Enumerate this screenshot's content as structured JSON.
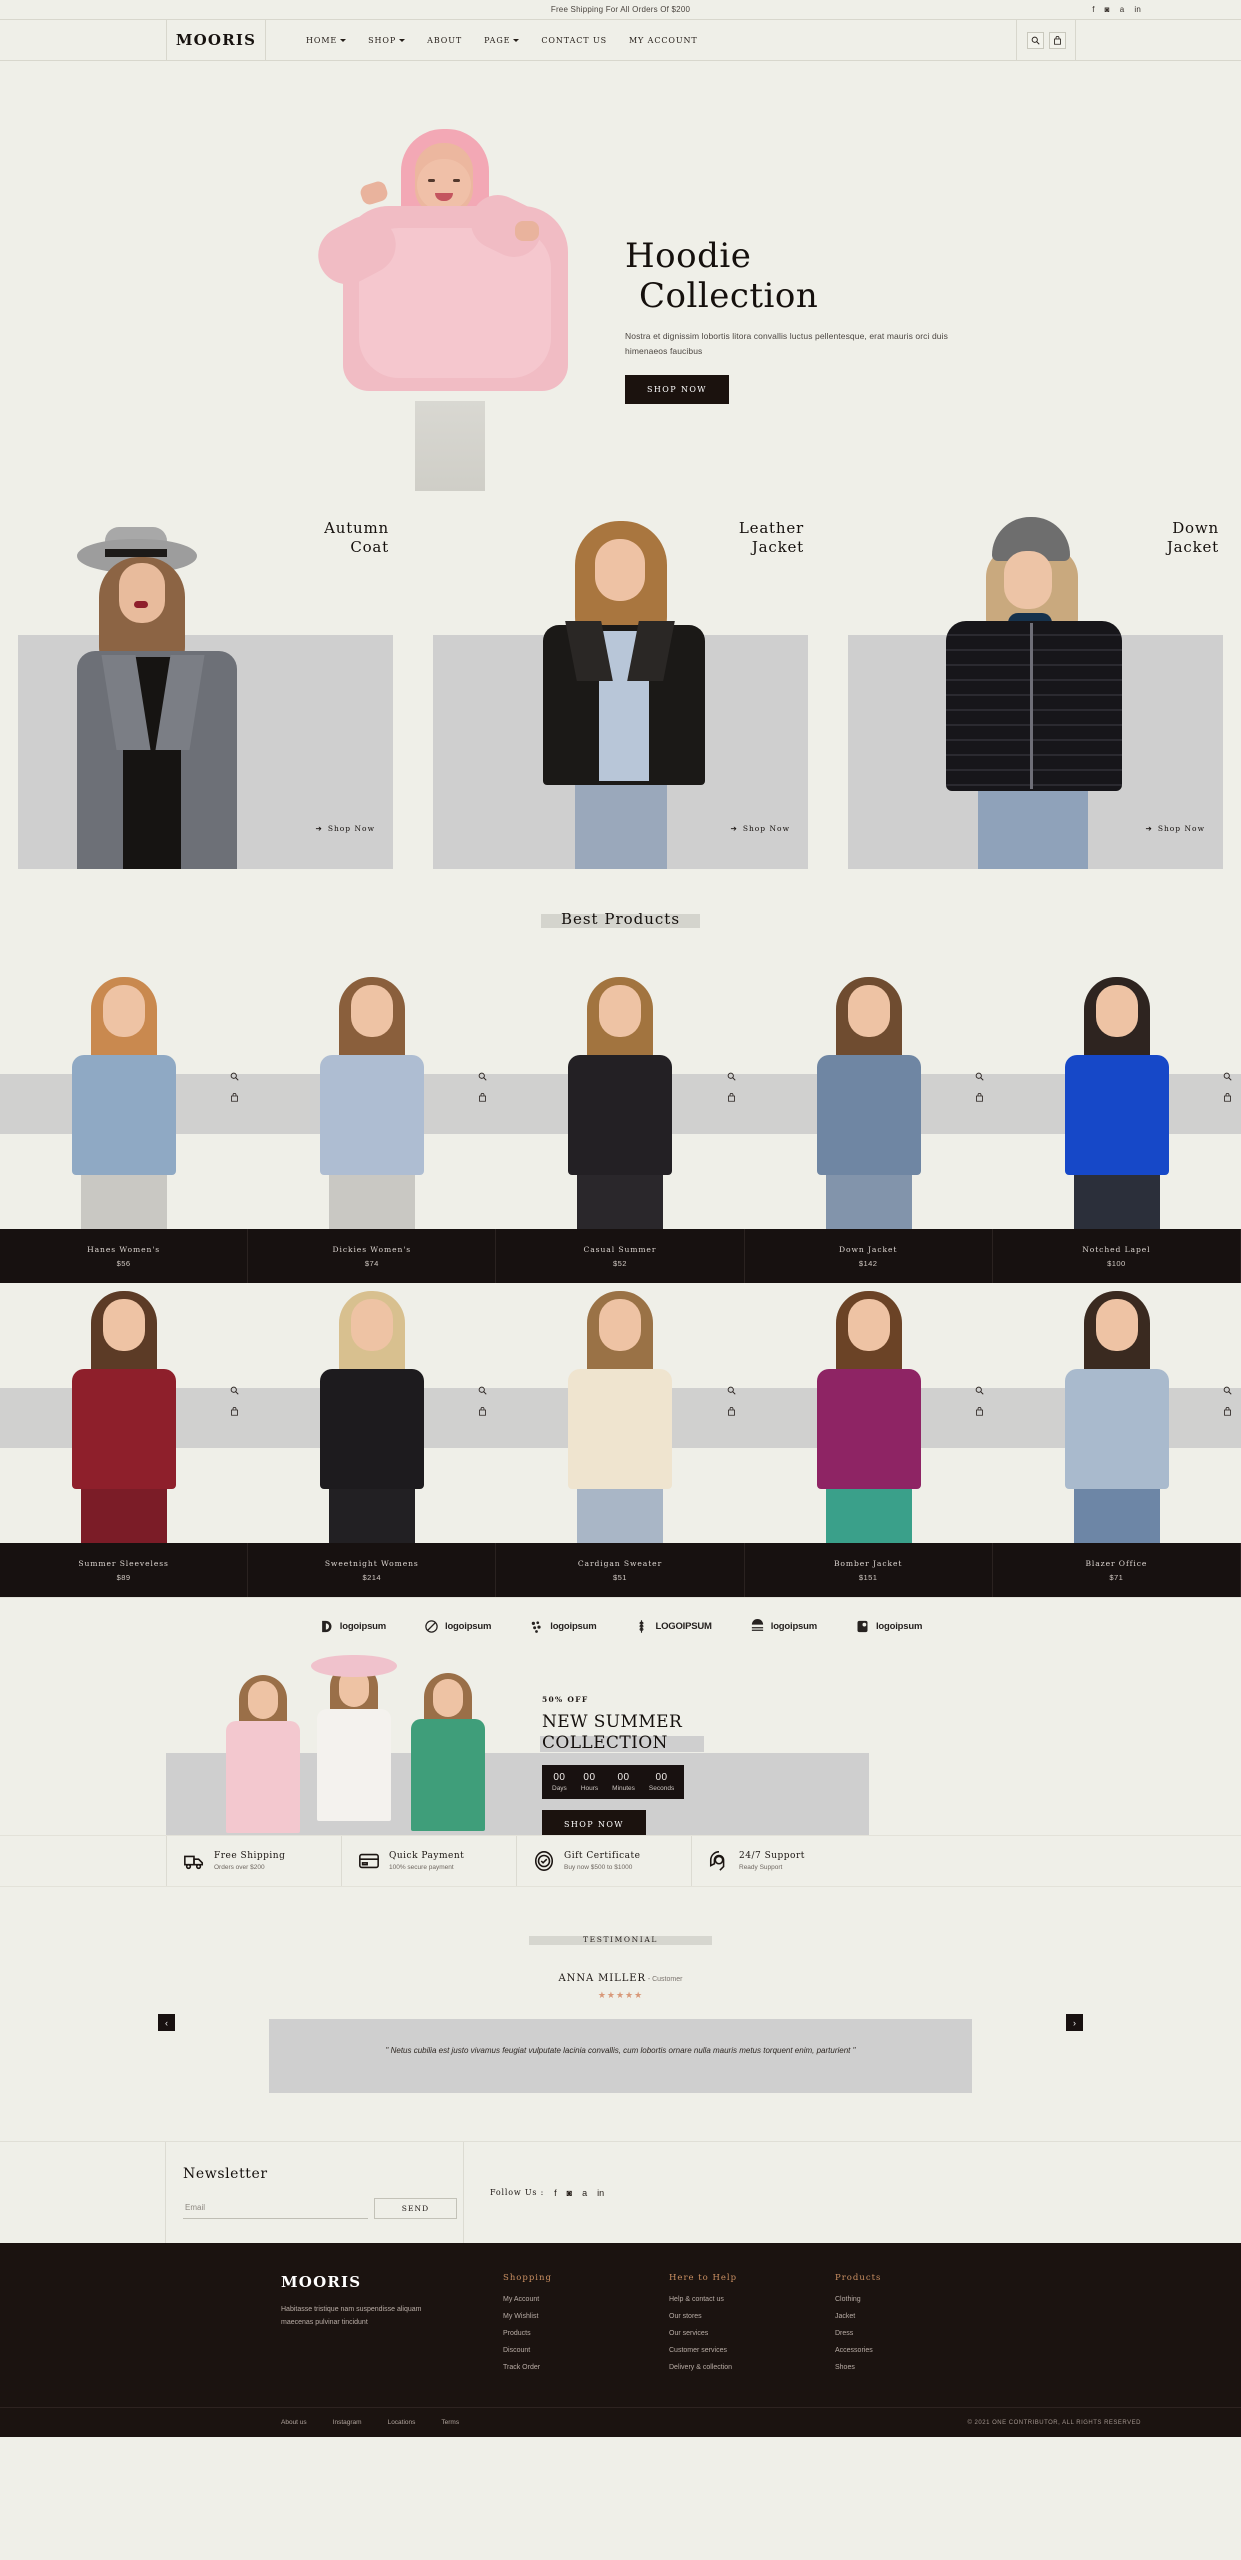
{
  "topbar": {
    "message": "Free Shipping For All Orders Of $200",
    "socials": [
      "facebook-icon",
      "instagram-icon",
      "amazon-icon",
      "linkedin-icon"
    ]
  },
  "header": {
    "logo": "MOORIS",
    "nav": [
      {
        "label": "HOME",
        "caret": true
      },
      {
        "label": "SHOP",
        "caret": true
      },
      {
        "label": "ABOUT",
        "caret": false
      },
      {
        "label": "PAGE",
        "caret": true
      },
      {
        "label": "CONTACT US",
        "caret": false
      },
      {
        "label": "MY ACCOUNT",
        "caret": false
      }
    ],
    "icons": [
      "search-icon",
      "bag-icon"
    ]
  },
  "hero": {
    "title_line1": "Hoodie",
    "title_line2": "Collection",
    "description": "Nostra et dignissim lobortis litora convallis luctus pellentesque, erat mauris orci duis himenaeos faucibus",
    "cta": "SHOP NOW"
  },
  "categories": [
    {
      "line1": "Autumn",
      "line2": "Coat",
      "cta": "Shop Now"
    },
    {
      "line1": "Leather",
      "line2": "Jacket",
      "cta": "Shop Now"
    },
    {
      "line1": "Down",
      "line2": "Jacket",
      "cta": "Shop Now"
    }
  ],
  "best_products": {
    "title": "Best Products",
    "items": [
      {
        "name": "Hanes Women's",
        "price": "$56"
      },
      {
        "name": "Dickies Women's",
        "price": "$74"
      },
      {
        "name": "Casual Summer",
        "price": "$52"
      },
      {
        "name": "Down Jacket",
        "price": "$142"
      },
      {
        "name": "Notched Lapel",
        "price": "$100"
      },
      {
        "name": "Summer Sleeveless",
        "price": "$89"
      },
      {
        "name": "Sweetnight Womens",
        "price": "$214"
      },
      {
        "name": "Cardigan Sweater",
        "price": "$51"
      },
      {
        "name": "Bomber Jacket",
        "price": "$151"
      },
      {
        "name": "Blazer Office",
        "price": "$71"
      }
    ],
    "tools": [
      "zoom-icon",
      "cart-icon"
    ]
  },
  "brands": [
    {
      "name": "logoipsum",
      "mark": "halfcircle-mark"
    },
    {
      "name": "logoipsum",
      "mark": "slashcircle-mark"
    },
    {
      "name": "logoipsum",
      "mark": "dots-mark"
    },
    {
      "name": "LOGOIPSUM",
      "mark": "wheat-mark"
    },
    {
      "name": "logoipsum",
      "mark": "waves-mark"
    },
    {
      "name": "logoipsum",
      "mark": "tag-mark"
    }
  ],
  "promo": {
    "discount": "50% OFF",
    "title_line1": "NEW SUMMER",
    "title_line2": "COLLECTION",
    "countdown": [
      {
        "value": "00",
        "label": "Days"
      },
      {
        "value": "00",
        "label": "Hours"
      },
      {
        "value": "00",
        "label": "Minutes"
      },
      {
        "value": "00",
        "label": "Seconds"
      }
    ],
    "cta": "SHOP NOW"
  },
  "services": [
    {
      "icon": "truck-icon",
      "title": "Free Shipping",
      "subtitle": "Orders over $200"
    },
    {
      "icon": "card-icon",
      "title": "Quick Payment",
      "subtitle": "100% secure payment"
    },
    {
      "icon": "check-badge-icon",
      "title": "Gift Certificate",
      "subtitle": "Buy now $500 to $1000"
    },
    {
      "icon": "support-icon",
      "title": "24/7 Support",
      "subtitle": "Ready Support"
    }
  ],
  "testimonial": {
    "label": "TESTIMONIAL",
    "name": "ANNA MILLER",
    "role": "- Customer",
    "stars": "★★★★★",
    "quote": "\" Netus cubilia est justo vivamus feugiat vulputate lacinia convallis, cum lobortis ornare nulla mauris metus torquent enim, parturient \"",
    "prev": "‹",
    "next": "›"
  },
  "newsletter": {
    "title": "Newsletter",
    "placeholder": "Email",
    "value": "",
    "send": "SEND",
    "follow_label": "Follow Us :",
    "socials": [
      "facebook-icon",
      "instagram-icon",
      "amazon-icon",
      "linkedin-icon"
    ]
  },
  "footer": {
    "logo": "MOORIS",
    "tagline": "Habitasse tristique nam suspendisse aliquam maecenas pulvinar tincidunt",
    "columns": [
      {
        "heading": "Shopping",
        "links": [
          "My Account",
          "My Wishlist",
          "Products",
          "Discount",
          "Track Order"
        ]
      },
      {
        "heading": "Here to Help",
        "links": [
          "Help & contact us",
          "Our stores",
          "Our services",
          "Customer services",
          "Delivery & collection"
        ]
      },
      {
        "heading": "Products",
        "links": [
          "Clothing",
          "Jacket",
          "Dress",
          "Accessories",
          "Shoes"
        ]
      }
    ],
    "bottom_links": [
      "About us",
      "Instagram",
      "Locations",
      "Terms"
    ],
    "copyright": "© 2021 ONE CONTRIBUTOR, ALL RIGHTS RESERVED"
  },
  "colors": {
    "page_bg": "#efefe8",
    "dark": "#1b1310",
    "panel_gray": "#cfcfcf",
    "accent": "#c98f62",
    "star": "#d89878"
  }
}
